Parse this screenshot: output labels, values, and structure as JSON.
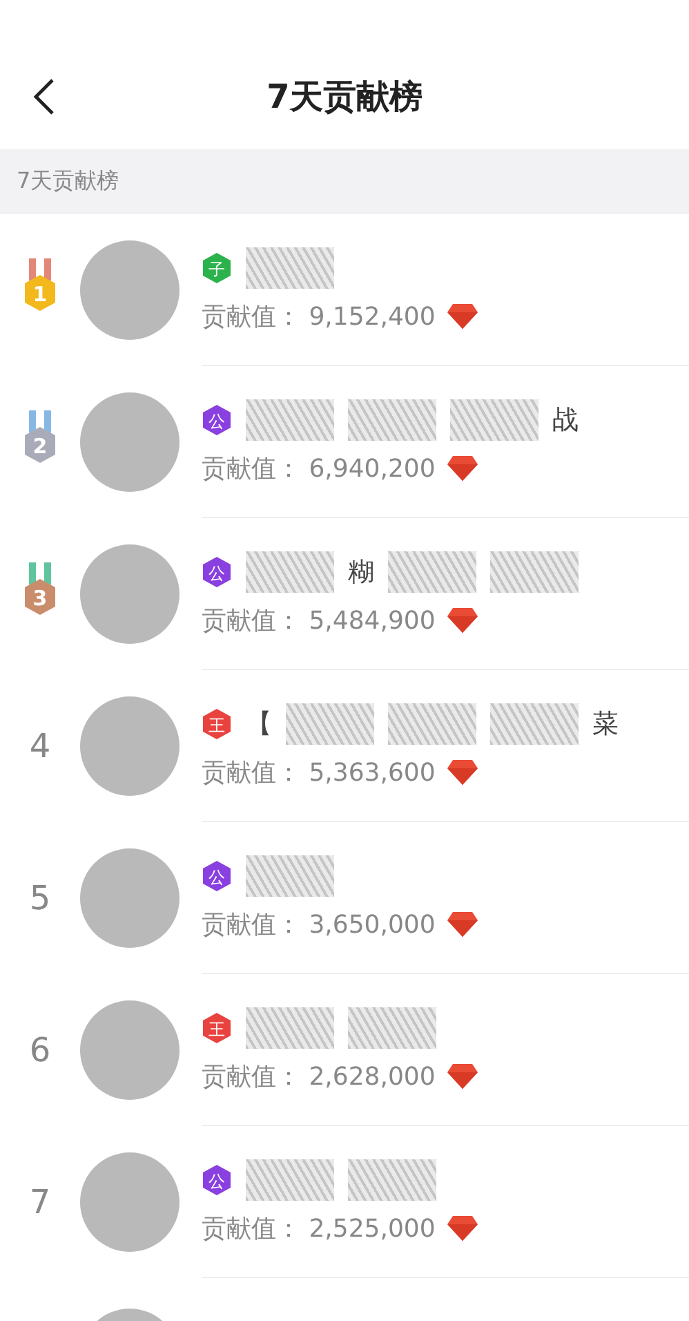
{
  "header": {
    "title": "7天贡献榜"
  },
  "section": {
    "label": "7天贡献榜"
  },
  "rows": [
    {
      "kind": "medal",
      "rank": "1",
      "color": "#f2b81c",
      "badge": {
        "label": "子",
        "color": "#2bb24c"
      },
      "name_parts": [
        {
          "kind": "scribble"
        }
      ],
      "value_label": "贡献值：",
      "value": "9,152,400"
    },
    {
      "kind": "medal",
      "rank": "2",
      "color": "#a9acb8",
      "badge": {
        "label": "公",
        "color": "#8a3fe0"
      },
      "name_parts": [
        {
          "kind": "scribble"
        },
        {
          "kind": "scribble"
        },
        {
          "kind": "scribble"
        },
        {
          "kind": "text",
          "text": "战"
        }
      ],
      "value_label": "贡献值：",
      "value": "6,940,200"
    },
    {
      "kind": "medal",
      "rank": "3",
      "color": "#c98d6c",
      "badge": {
        "label": "公",
        "color": "#8a3fe0"
      },
      "name_parts": [
        {
          "kind": "scribble"
        },
        {
          "kind": "text",
          "text": "糊"
        },
        {
          "kind": "scribble"
        },
        {
          "kind": "scribble"
        }
      ],
      "value_label": "贡献值：",
      "value": "5,484,900"
    },
    {
      "kind": "number",
      "rank": "4",
      "badge": {
        "label": "王",
        "color": "#e8433f"
      },
      "name_parts": [
        {
          "kind": "text",
          "text": "【"
        },
        {
          "kind": "scribble"
        },
        {
          "kind": "scribble"
        },
        {
          "kind": "scribble"
        },
        {
          "kind": "text",
          "text": "菜"
        }
      ],
      "value_label": "贡献值：",
      "value": "5,363,600"
    },
    {
      "kind": "number",
      "rank": "5",
      "badge": {
        "label": "公",
        "color": "#8a3fe0"
      },
      "name_parts": [
        {
          "kind": "scribble"
        }
      ],
      "value_label": "贡献值：",
      "value": "3,650,000"
    },
    {
      "kind": "number",
      "rank": "6",
      "badge": {
        "label": "王",
        "color": "#e8433f"
      },
      "name_parts": [
        {
          "kind": "scribble"
        },
        {
          "kind": "scribble"
        }
      ],
      "value_label": "贡献值：",
      "value": "2,628,000"
    },
    {
      "kind": "number",
      "rank": "7",
      "badge": {
        "label": "公",
        "color": "#8a3fe0"
      },
      "name_parts": [
        {
          "kind": "scribble"
        },
        {
          "kind": "scribble"
        }
      ],
      "value_label": "贡献值：",
      "value": "2,525,000"
    }
  ]
}
